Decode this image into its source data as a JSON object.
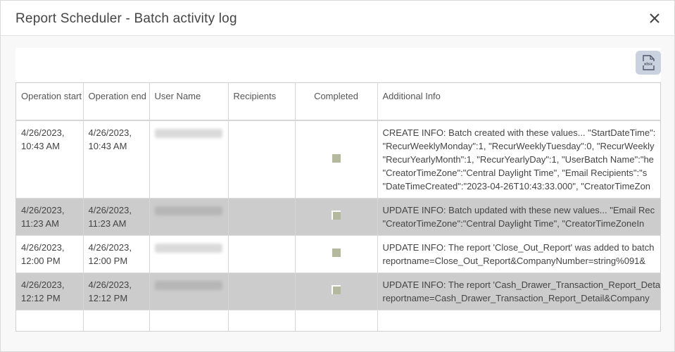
{
  "dialog": {
    "title": "Report Scheduler - Batch activity log",
    "close_icon": "close-icon"
  },
  "toolbar": {
    "export_icon": "xlsx-export-icon",
    "export_glyph": "xlsx"
  },
  "table": {
    "columns": [
      "Operation start",
      "Operation end",
      "User Name",
      "Recipients",
      "Completed",
      "Additional Info"
    ],
    "rows": [
      {
        "start": "4/26/2023, 10:43 AM",
        "end": "4/26/2023, 10:43 AM",
        "completed": true,
        "info": [
          "CREATE INFO: Batch created with these values... \"StartDateTime\":",
          "\"RecurWeeklyMonday\":1, \"RecurWeeklyTuesday\":0, \"RecurWeekly",
          "\"RecurYearlyMonth\":1, \"RecurYearlyDay\":1, \"UserBatch Name\":\"he",
          "\"CreatorTimeZone\":\"Central Daylight Time\", \"Email Recipients\":\"s",
          "\"DateTimeCreated\":\"2023-04-26T10:43:33.000\", \"CreatorTimeZon"
        ]
      },
      {
        "start": "4/26/2023, 11:23 AM",
        "end": "4/26/2023, 11:23 AM",
        "completed": true,
        "info": [
          "UPDATE INFO: Batch updated with these new values... \"Email Rec",
          "\"CreatorTimeZone\":\"Central Daylight Time\", \"CreatorTimeZoneIn"
        ]
      },
      {
        "start": "4/26/2023, 12:00 PM",
        "end": "4/26/2023, 12:00 PM",
        "completed": true,
        "info": [
          "UPDATE INFO: The report 'Close_Out_Report' was added to batch",
          "reportname=Close_Out_Report&CompanyNumber=string%091&"
        ]
      },
      {
        "start": "4/26/2023, 12:12 PM",
        "end": "4/26/2023, 12:12 PM",
        "completed": true,
        "info": [
          "UPDATE INFO: The report 'Cash_Drawer_Transaction_Report_Detai",
          "reportname=Cash_Drawer_Transaction_Report_Detail&Company"
        ]
      }
    ]
  }
}
